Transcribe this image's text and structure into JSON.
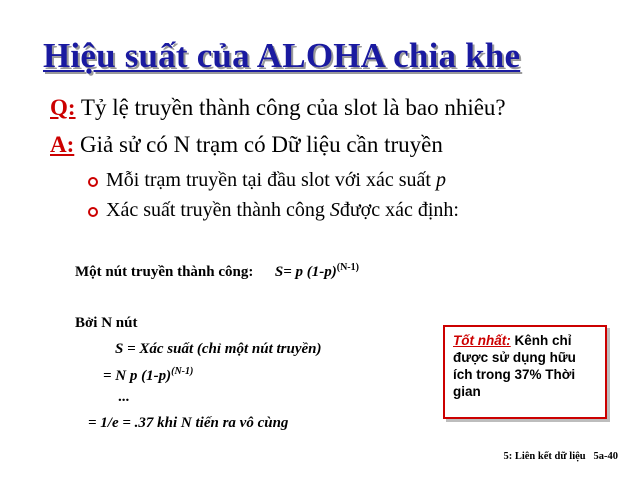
{
  "title": "Hiệu suất của ALOHA chia khe",
  "question": {
    "label": "Q:",
    "text": " Tỷ lệ truyền thành công của slot là bao nhiêu?"
  },
  "answer": {
    "label": "A:",
    "text": " Giả sử có N trạm có Dữ liệu cần truyền"
  },
  "bullets": [
    {
      "text": "Mỗi trạm truyền tại đầu slot với xác suất ",
      "var": "p"
    },
    {
      "text": "Xác suất truyền thành công ",
      "var": "S",
      "tail": " được xác định:"
    }
  ],
  "formula1": {
    "label": "Một nút truyền thành công:",
    "expr": "S= p (1-p)",
    "exp": "(N-1)"
  },
  "by_n": {
    "label": "Bởi N nút",
    "line1": "S = Xác suất (chỉ một nút truyền)",
    "line2": "= N p (1-p)",
    "line2_exp": "(N-1)",
    "dots": "...",
    "line3": "= 1/e = .37 khi N tiến ra vô cùng"
  },
  "note": {
    "label": "Tốt nhất:",
    "text": " Kênh chỉ được sử dụng hữu ích trong 37% Thời gian"
  },
  "footer": {
    "chapter": "5: Liên kết dữ liệu",
    "page": "5a-40"
  },
  "colors": {
    "title": "#1a1aa0",
    "accent": "#cc0000"
  }
}
